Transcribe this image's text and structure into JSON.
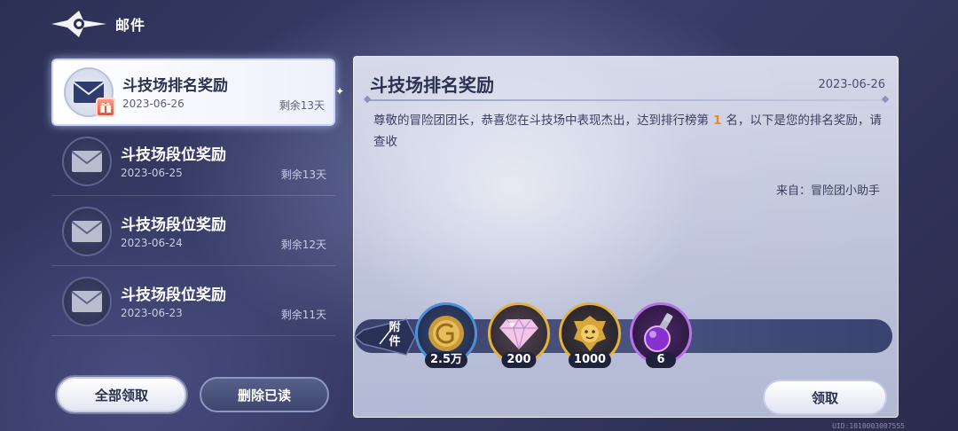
{
  "header": {
    "title": "邮件"
  },
  "mails": [
    {
      "title": "斗技场排名奖励",
      "date": "2023-06-26",
      "remain": "剩余13天",
      "selected": true
    },
    {
      "title": "斗技场段位奖励",
      "date": "2023-06-25",
      "remain": "剩余13天"
    },
    {
      "title": "斗技场段位奖励",
      "date": "2023-06-24",
      "remain": "剩余12天"
    },
    {
      "title": "斗技场段位奖励",
      "date": "2023-06-23",
      "remain": "剩余11天"
    }
  ],
  "buttons": {
    "claim_all": "全部领取",
    "delete_read": "删除已读",
    "claim": "领取"
  },
  "detail": {
    "title": "斗技场排名奖励",
    "date": "2023-06-26",
    "body_before": "尊敬的冒险团团长，恭喜您在斗技场中表现杰出，达到排行榜第",
    "rank": "1",
    "body_after": "名，以下是您的排名奖励，请查收",
    "sender": "来自：冒险团小助手"
  },
  "attachments": {
    "label_top": "附",
    "label_bottom": "件",
    "items": [
      {
        "icon": "gold-coin-icon",
        "qty": "2.5万"
      },
      {
        "icon": "diamond-icon",
        "qty": "200"
      },
      {
        "icon": "lion-emblem-icon",
        "qty": "1000"
      },
      {
        "icon": "purple-potion-icon",
        "qty": "6"
      }
    ]
  },
  "uid": "UID:1010003007555"
}
